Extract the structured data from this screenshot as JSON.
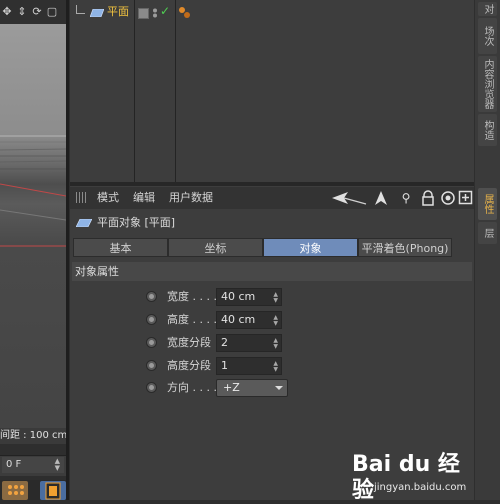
{
  "viewport": {
    "toolbar_icons": [
      "move-icon",
      "updown-icon",
      "rotate-icon",
      "render-icon"
    ],
    "toolbar_glyphs": [
      "✥",
      "⇕",
      "⟳",
      "▢"
    ],
    "status_text": "间距 : 100 cm"
  },
  "timeline": {
    "frame_value": "0 F"
  },
  "object_manager": {
    "objects": [
      {
        "name": "平面",
        "icon": "plane-icon",
        "visible": true
      }
    ]
  },
  "attribute_manager": {
    "menu": [
      "模式",
      "编辑",
      "用户数据"
    ],
    "toolbar_icons": [
      "back-arrow-icon",
      "up-arrow-icon",
      "search-icon",
      "lock-icon",
      "target-icon",
      "new-window-icon"
    ],
    "title": "平面对象 [平面]",
    "tabs": [
      {
        "label": "基本",
        "active": false
      },
      {
        "label": "坐标",
        "active": false
      },
      {
        "label": "对象",
        "active": true
      },
      {
        "label": "平滑着色(Phong)",
        "active": false
      }
    ],
    "section_title": "对象属性",
    "params": [
      {
        "label": "宽度 . . . .",
        "value": "40 cm",
        "type": "number"
      },
      {
        "label": "高度 . . . .",
        "value": "40 cm",
        "type": "number"
      },
      {
        "label": "宽度分段",
        "value": "2",
        "type": "number"
      },
      {
        "label": "高度分段",
        "value": "1",
        "type": "number"
      },
      {
        "label": "方向 . . . .",
        "value": "+Z",
        "type": "select"
      }
    ]
  },
  "right_tabs": [
    "对象",
    "场次",
    "内容浏览器",
    "构造",
    "属性",
    "层"
  ],
  "watermark": {
    "logo": "Bai du 经验",
    "url": "jingyan.baidu.com"
  },
  "colors": {
    "accent_tab": "#6f8cba",
    "object_name": "#f1c23f",
    "check": "#4fcf52"
  }
}
